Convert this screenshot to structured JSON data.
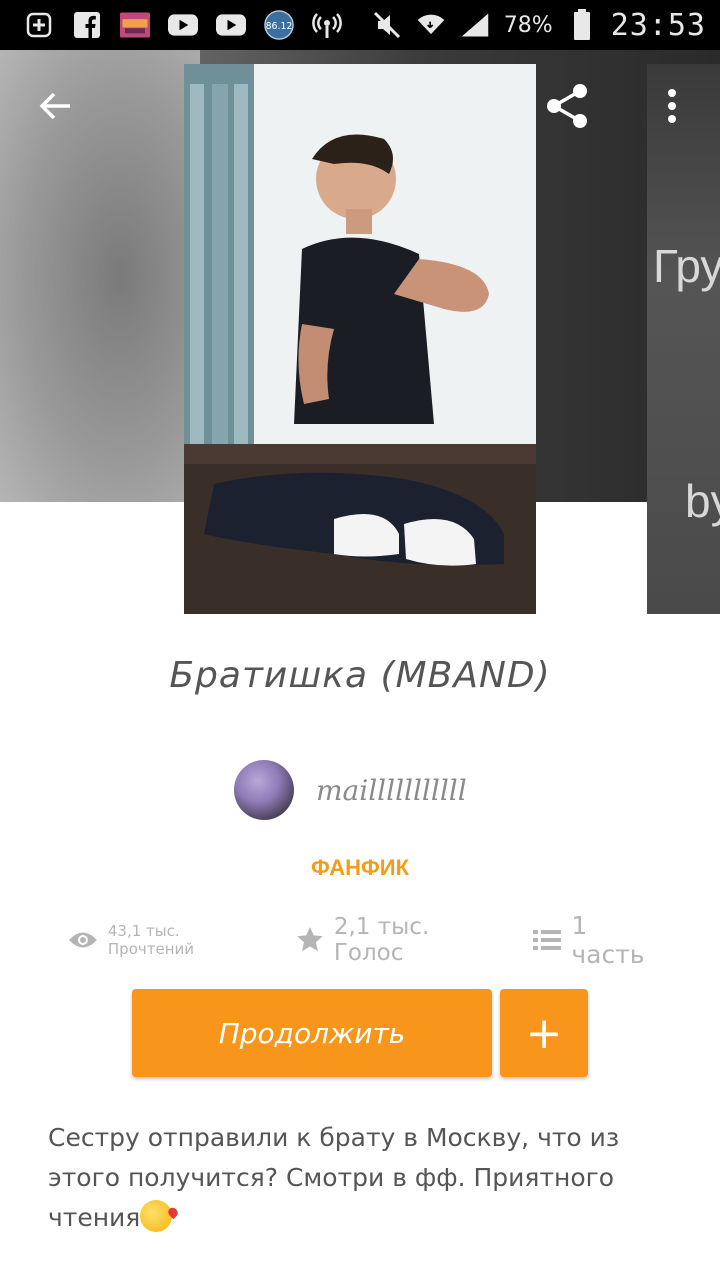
{
  "status_bar": {
    "battery": "78%",
    "time": "23:53",
    "badge": "86.12",
    "icons": [
      "plus-box-icon",
      "facebook-icon",
      "app-thumbnail-icon",
      "youtube-icon",
      "youtube-icon",
      "badge-icon",
      "wifi-hotspot-icon",
      "mute-icon",
      "wifi-icon",
      "signal-icon",
      "battery-icon"
    ]
  },
  "toolbar": {
    "back_icon": "arrow-left-icon",
    "share_icon": "share-icon",
    "menu_icon": "more-vert-icon"
  },
  "story": {
    "title": "Братишка (MBAND)",
    "author": "mailllllllllll",
    "category": "ФАНФИК",
    "reads": "43,1 тыс. Прочтений",
    "votes": "2,1 тыс. Голос",
    "parts": "1 часть",
    "continue_label": "Продолжить",
    "add_label": "+",
    "description": "Сестру отправили к брату в Москву, что из этого получится? Смотри в фф. Приятного чтения"
  },
  "side_cover": {
    "text_top": "Груб",
    "text_bottom": "by"
  },
  "colors": {
    "accent": "#f8961b",
    "category": "#f39c1b",
    "text": "#555555",
    "muted": "#b5b5b5"
  }
}
